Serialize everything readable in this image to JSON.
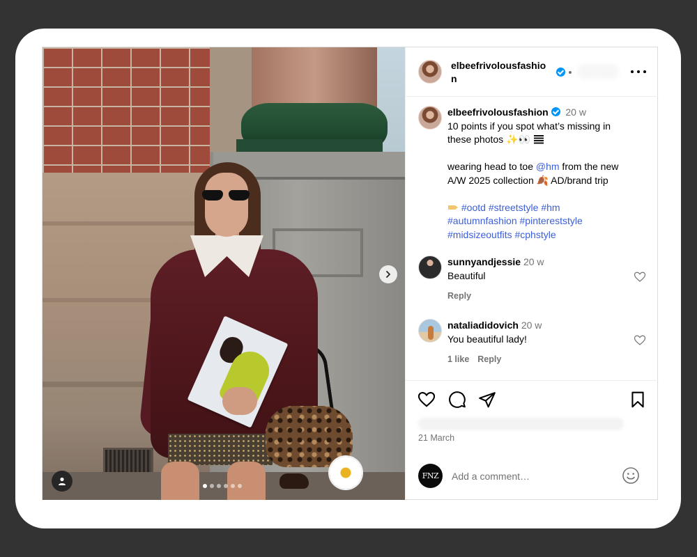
{
  "post": {
    "username": "elbeefrivolousfashion",
    "header_username_line1": "elbeefrivolousfashio",
    "header_username_line2": "n",
    "carousel": {
      "slides": 6,
      "active_index": 0
    }
  },
  "caption": {
    "time": "20 w",
    "line1": "10 points if you spot what’s missing in",
    "line2": "these photos ✨👀",
    "line3_pre": "wearing head to toe ",
    "mention": "@hm",
    "line3_post": " from the new",
    "line4": "A/W 2025 collection 🍂 AD/brand trip",
    "hashtags_line1": [
      "#ootd",
      "#streetstyle",
      "#hm"
    ],
    "hashtags_line2": [
      "#autumnfashion",
      "#pinterest style"
    ],
    "hashtags_line2_text": "#autumnfashion #pinterest",
    "hashtags_line2_tail": "style",
    "hashtags_line3": [
      "#midsizeoutfits",
      "#cphstyle"
    ]
  },
  "comments": [
    {
      "username": "sunnyandjessie",
      "time": "20 w",
      "text": "Beautiful",
      "reply_label": "Reply"
    },
    {
      "username": "nataliadidovich",
      "time": "20 w",
      "text": "You beautiful lady!",
      "likes_label": "1 like",
      "reply_label": "Reply"
    }
  ],
  "icons": {
    "like": "heart-icon",
    "comment": "comment-icon",
    "share": "send-icon",
    "save": "bookmark-icon",
    "more": "more-options-icon",
    "next": "chevron-right-icon",
    "tag": "user-tag-icon",
    "emoji": "smiley-icon"
  },
  "date": "21 March",
  "comment_box": {
    "avatar_text": "FNZ",
    "placeholder": "Add a comment…"
  },
  "colors": {
    "verified": "#0095f6",
    "link": "#3b5ed8",
    "muted": "#737373",
    "backdrop": "#333333"
  }
}
